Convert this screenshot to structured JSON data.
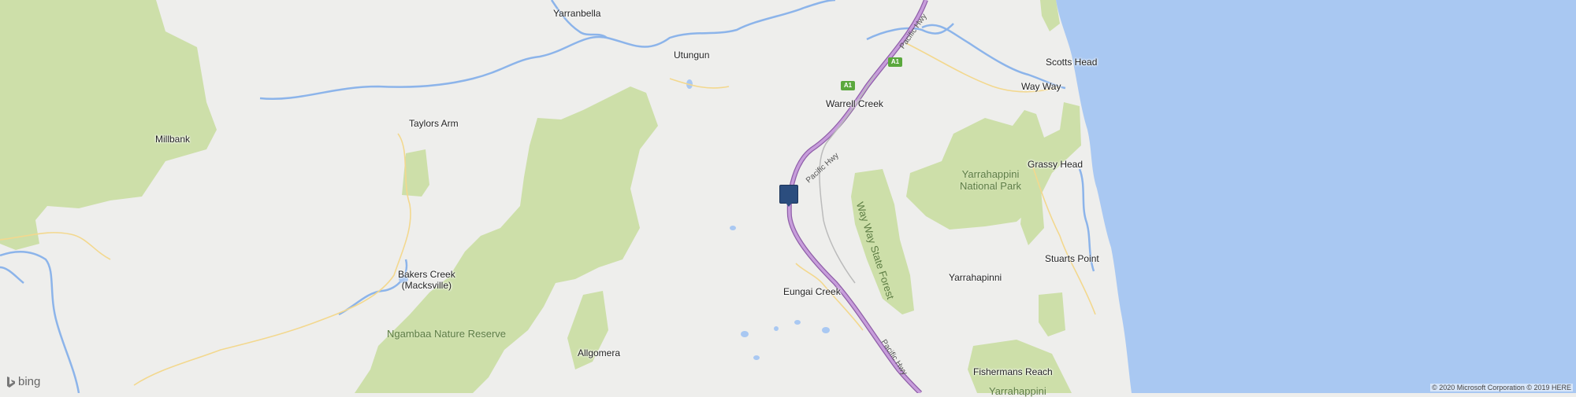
{
  "map": {
    "colors": {
      "land": "#eeeeec",
      "water": "#a9c8f2",
      "park": "#cddfa9",
      "river": "#8cb4ea",
      "highway": "#c79ddb",
      "highway_casing": "#8f5fa8",
      "local_road": "#f3d88e",
      "marker": "#2b4d7e"
    },
    "places": [
      {
        "id": "yarranbella",
        "label": "Yarranbella"
      },
      {
        "id": "utungun",
        "label": "Utungun"
      },
      {
        "id": "scotts-head",
        "label": "Scotts Head"
      },
      {
        "id": "way-way",
        "label": "Way Way"
      },
      {
        "id": "warrell-creek",
        "label": "Warrell Creek"
      },
      {
        "id": "taylors-arm",
        "label": "Taylors Arm"
      },
      {
        "id": "millbank",
        "label": "Millbank"
      },
      {
        "id": "grassy-head",
        "label": "Grassy Head"
      },
      {
        "id": "stuarts-point",
        "label": "Stuarts Point"
      },
      {
        "id": "yarrahapinni",
        "label": "Yarrahapinni"
      },
      {
        "id": "eungai-creek",
        "label": "Eungai Creek"
      },
      {
        "id": "bakers-creek",
        "label": "Bakers Creek\n(Macksville)"
      },
      {
        "id": "allgomera",
        "label": "Allgomera"
      },
      {
        "id": "fishermans-reach",
        "label": "Fishermans Reach"
      }
    ],
    "parks": [
      {
        "id": "yarrahappini-np",
        "label": "Yarrahappini\nNational Park"
      },
      {
        "id": "ngambaa-nr",
        "label": "Ngambaa Nature Reserve"
      },
      {
        "id": "way-way-sf",
        "label": "Way Way State Forest"
      },
      {
        "id": "yarrahappini-bottom",
        "label": "Yarrahappini"
      }
    ],
    "road_labels": [
      {
        "id": "pacific-hwy-1",
        "label": "Pacific Hwy"
      },
      {
        "id": "pacific-hwy-2",
        "label": "Pacific Hwy"
      },
      {
        "id": "pacific-hwy-3",
        "label": "Pacific Hwy"
      }
    ],
    "route_shields": [
      {
        "id": "a1-1",
        "label": "A1"
      },
      {
        "id": "a1-2",
        "label": "A1"
      }
    ],
    "marker_icon": "location-marker-square",
    "logo": {
      "icon": "bing-logo",
      "text": "bing"
    },
    "copyright": "© 2020 Microsoft Corporation © 2019 HERE"
  }
}
